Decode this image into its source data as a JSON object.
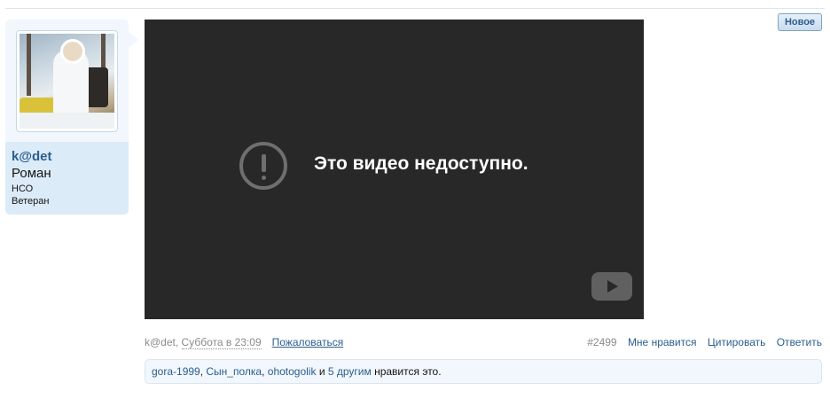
{
  "user": {
    "username": "k@det",
    "real_name": "Роман",
    "region": "НСО",
    "rank": "Ветеран"
  },
  "video": {
    "message": "Это видео недоступно."
  },
  "post": {
    "new_badge": "Новое",
    "author": "k@det",
    "comma": ", ",
    "time": "Суббота в 23:09",
    "report_label": "Пожаловаться",
    "number": "#2499",
    "like_label": "Мне нравится",
    "quote_label": "Цитировать",
    "reply_label": "Ответить"
  },
  "likes": {
    "users": [
      "gora-1999",
      "Сын_полка",
      "ohotogolik"
    ],
    "separator": ", ",
    "and": " и ",
    "others_label": "5 другим",
    "suffix": " нравится это."
  },
  "colors": {
    "link": "#2b5e8e",
    "video_bg": "#282828",
    "sidebar_bg": "#dcebf8"
  }
}
